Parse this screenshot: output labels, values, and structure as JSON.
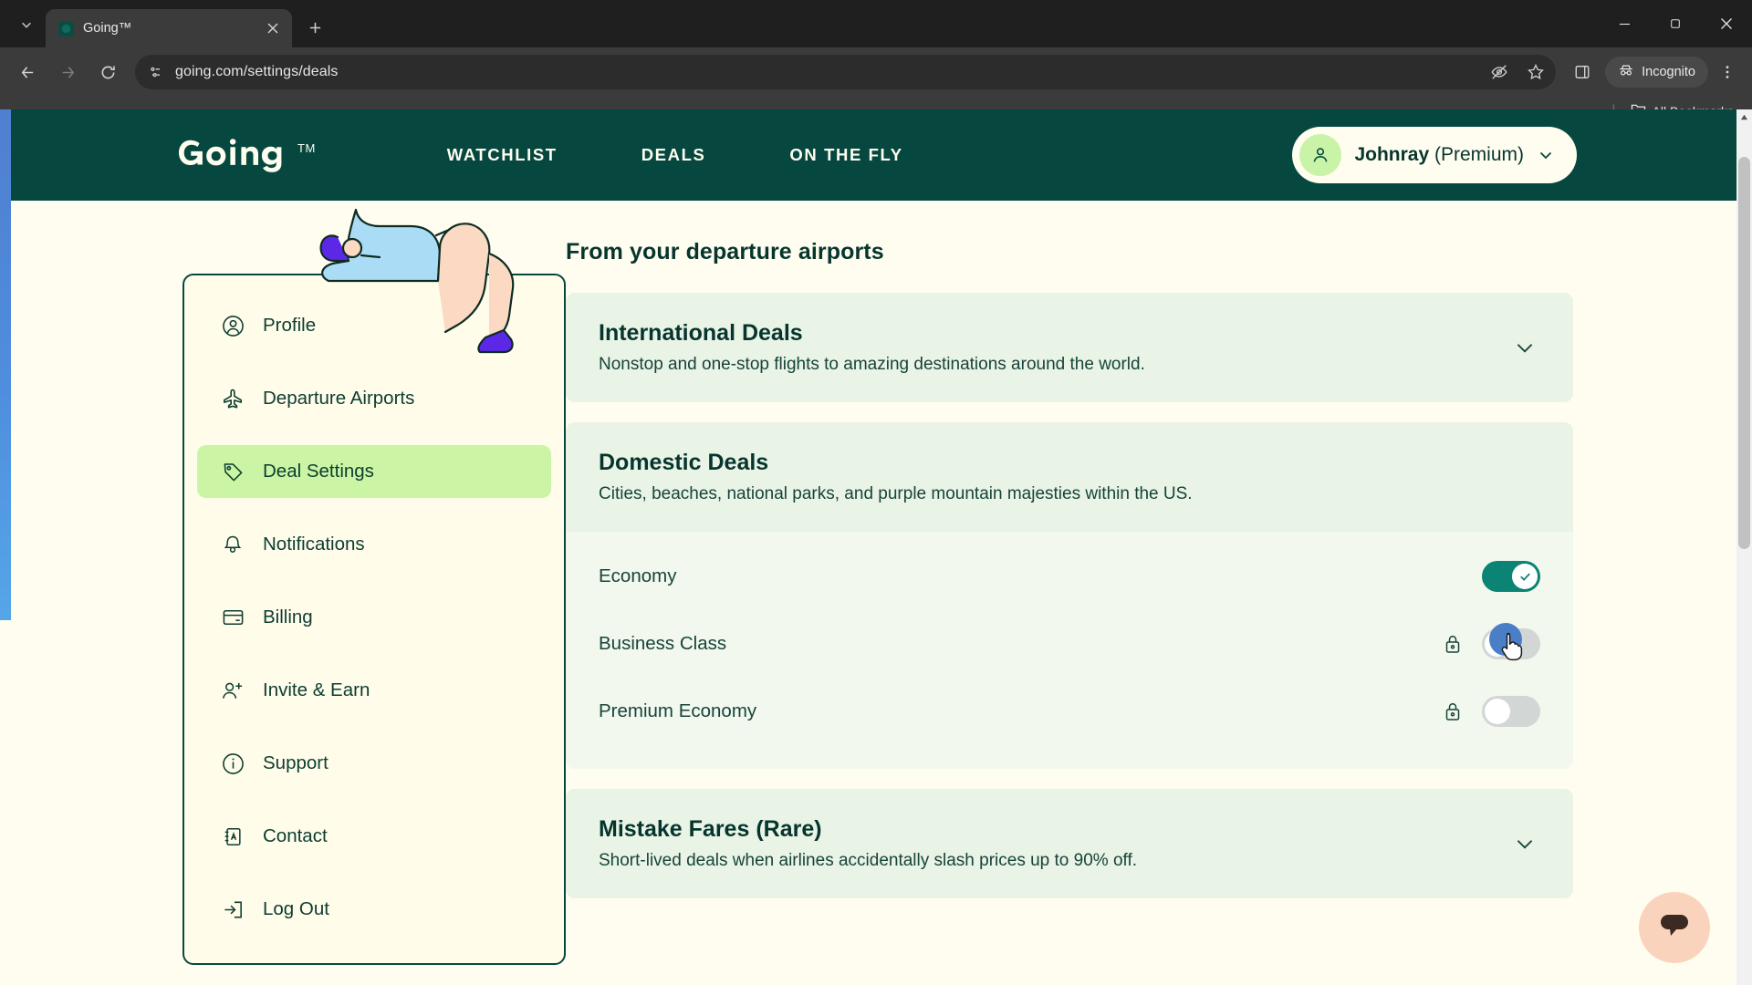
{
  "browser": {
    "tab": {
      "title": "Going™",
      "favicon": "going-favicon",
      "close_label": "✕"
    },
    "new_tab_label": "+",
    "tab_list_label": "⌄",
    "window": {
      "minimize": "—",
      "maximize": "▢",
      "close": "✕"
    },
    "nav": {
      "back": "←",
      "forward": "→",
      "reload": "⟳"
    },
    "omnibox": {
      "url": "going.com/settings/deals",
      "site_info_icon": "page-info-icon"
    },
    "toolbar_icons": [
      "eye-off-icon",
      "star-icon",
      "side-panel-icon"
    ],
    "incognito_label": "Incognito",
    "menu_label": "⋮",
    "bookmarks": {
      "separator": "|",
      "all_bookmarks_label": "All Bookmarks",
      "folder_icon": "folder-icon"
    }
  },
  "site": {
    "logo_text": "Going",
    "logo_tm": "TM",
    "nav": [
      {
        "label": "WATCHLIST"
      },
      {
        "label": "DEALS"
      },
      {
        "label": "ON THE FLY"
      }
    ],
    "profile": {
      "name": "Johnray",
      "tier": "(Premium)",
      "avatar_icon": "person-icon",
      "chevron_icon": "chevron-down-icon"
    }
  },
  "sidebar": {
    "items": [
      {
        "label": "Profile",
        "icon": "profile-circle-icon",
        "active": false
      },
      {
        "label": "Departure Airports",
        "icon": "airplane-icon",
        "active": false
      },
      {
        "label": "Deal Settings",
        "icon": "tag-icon",
        "active": true
      },
      {
        "label": "Notifications",
        "icon": "bell-icon",
        "active": false
      },
      {
        "label": "Billing",
        "icon": "credit-card-icon",
        "active": false
      },
      {
        "label": "Invite & Earn",
        "icon": "person-add-icon",
        "active": false
      },
      {
        "label": "Support",
        "icon": "info-circle-icon",
        "active": false
      },
      {
        "label": "Contact",
        "icon": "address-book-icon",
        "active": false
      },
      {
        "label": "Log Out",
        "icon": "logout-icon",
        "active": false
      }
    ]
  },
  "main": {
    "section_title": "From your departure airports",
    "cards": [
      {
        "title": "International Deals",
        "description": "Nonstop and one-stop flights to amazing destinations around the world.",
        "chevron_icon": "chevron-down-icon",
        "expanded": false
      },
      {
        "title": "Domestic Deals",
        "description": "Cities, beaches, national parks, and purple mountain majesties within the US.",
        "chevron_icon": "chevron-down-icon",
        "expanded": true,
        "toggles": [
          {
            "label": "Economy",
            "on": true,
            "locked": false,
            "check_icon": "check-icon"
          },
          {
            "label": "Business Class",
            "on": false,
            "locked": true,
            "lock_icon": "lock-icon"
          },
          {
            "label": "Premium Economy",
            "on": false,
            "locked": true,
            "lock_icon": "lock-icon"
          }
        ]
      },
      {
        "title": "Mistake Fares (Rare)",
        "description": "Short-lived deals when airlines accidentally slash prices up to 90% off.",
        "chevron_icon": "chevron-down-icon",
        "expanded": false
      }
    ]
  },
  "widgets": {
    "chat_icon": "message-bubble-icon"
  },
  "colors": {
    "brand_dark_green": "#06483f",
    "page_cream": "#fffdf0",
    "card_green": "#e9f3e6",
    "active_sidebar": "#cbf5a4",
    "toggle_on": "#0b8375",
    "toggle_off": "#d2d6d4",
    "click_indicator": "#4a7fc8",
    "chat_fab": "#fad3bd"
  }
}
